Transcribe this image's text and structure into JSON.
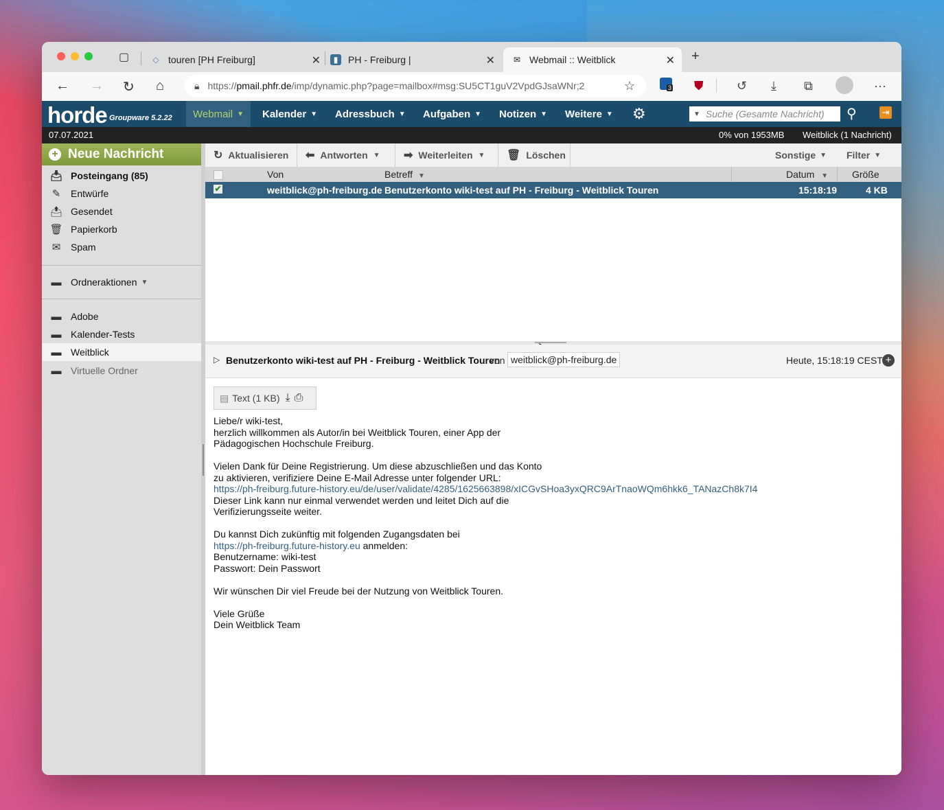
{
  "browser": {
    "tabs": [
      {
        "label": "touren [PH Freiburg]",
        "icon": "code-diamond-icon"
      },
      {
        "label": "PH - Freiburg |",
        "icon": "ph-logo-icon"
      },
      {
        "label": "Webmail :: Weitblick",
        "icon": "mail-icon"
      }
    ],
    "url_prefix": "https://",
    "url_host": "pmail.phfr.de",
    "url_path": "/imp/dynamic.php?page=mailbox#msg:SU5CT1guV2VpdGJsaWNr;2",
    "extension_badge": "3"
  },
  "horde": {
    "logo": "horde",
    "version": "Groupware 5.2.22",
    "menu": [
      "Webmail",
      "Kalender",
      "Adressbuch",
      "Aufgaben",
      "Notizen",
      "Weitere"
    ],
    "search_placeholder": "Suche (Gesamte Nachricht)",
    "date": "07.07.2021",
    "quota": "0% von 1953MB",
    "mailbox_status": "Weitblick (1 Nachricht)"
  },
  "sidebar": {
    "new_message": "Neue Nachricht",
    "folders": [
      {
        "label": "Posteingang (85)",
        "icon": "inbox-icon"
      },
      {
        "label": "Entwürfe",
        "icon": "drafts-icon"
      },
      {
        "label": "Gesendet",
        "icon": "sent-icon"
      },
      {
        "label": "Papierkorb",
        "icon": "trash-icon"
      },
      {
        "label": "Spam",
        "icon": "spam-icon"
      }
    ],
    "folder_actions": "Ordneraktionen",
    "custom_folders": [
      {
        "label": "Adobe"
      },
      {
        "label": "Kalender-Tests"
      },
      {
        "label": "Weitblick"
      },
      {
        "label": "Virtuelle Ordner"
      }
    ]
  },
  "toolbar": {
    "refresh": "Aktualisieren",
    "reply": "Antworten",
    "forward": "Weiterleiten",
    "delete": "Löschen",
    "other": "Sonstige",
    "filter": "Filter"
  },
  "list": {
    "columns": {
      "from": "Von",
      "subject": "Betreff",
      "date": "Datum",
      "size": "Größe"
    },
    "rows": [
      {
        "from": "weitblick@ph-freiburg.de",
        "subject": "Benutzerkonto wiki-test auf PH - Freiburg - Weitblick Touren",
        "date": "15:18:19",
        "size": "4 KB"
      }
    ]
  },
  "message": {
    "subject": "Benutzerkonto wiki-test auf PH - Freiburg -  Weitblick Touren",
    "from_label": "von",
    "from": "weitblick@ph-freiburg.de",
    "date": "Heute, 15:18:19 CEST",
    "attachment": "Text (1 KB)",
    "body": [
      "Liebe/r wiki-test,",
      "herzlich willkommen als Autor/in bei Weitblick Touren, einer App der",
      "Pädagogischen Hochschule Freiburg.",
      "",
      "Vielen Dank für Deine Registrierung. Um diese abzuschließen und das Konto",
      "zu aktivieren, verifiziere Deine E-Mail Adresse unter folgender URL:",
      "https://ph-freiburg.future-history.eu/de/user/validate/4285/1625663898/xICGvSHoa3yxQRC9ArTnaoWQm6hkk6_TANazCh8k7I4",
      "Dieser Link kann nur einmal verwendet werden und leitet Dich auf die",
      "Verifizierungsseite weiter.",
      "",
      "Du kannst Dich zukünftig mit folgenden Zugangsdaten bei",
      "https://ph-freiburg.future-history.eu",
      "Benutzername:  wiki-test",
      "Passwort: Dein Passwort",
      "",
      "Wir wünschen Dir viel Freude bei der Nutzung von Weitblick Touren.",
      "",
      "Viele Grüße",
      "Dein Weitblick Team"
    ],
    "login_suffix": " anmelden:"
  }
}
